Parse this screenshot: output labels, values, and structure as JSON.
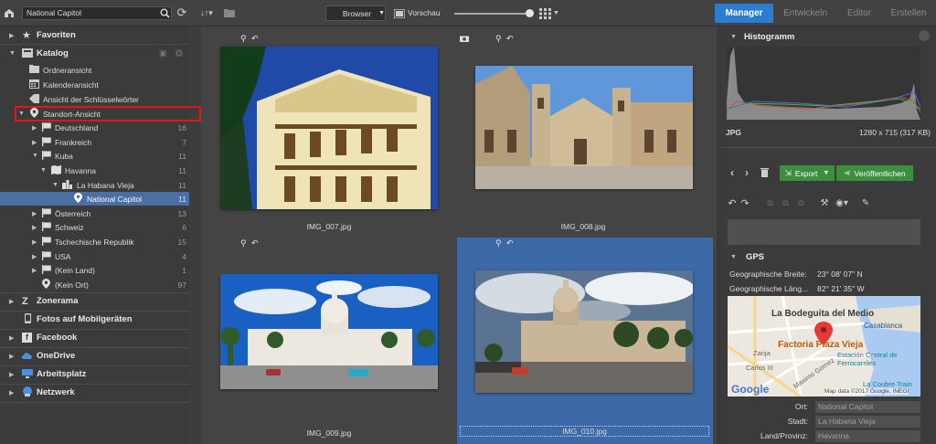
{
  "toolbar": {
    "search_value": "National Capitol",
    "browser_label": "Browser",
    "preview_label": "Vorschau"
  },
  "modes": {
    "manager": "Manager",
    "develop": "Entwickeln",
    "editor": "Editor",
    "create": "Erstellen"
  },
  "sidebar": {
    "favorites": "Favoriten",
    "catalog": "Katalog",
    "folder_view": "Ordneransicht",
    "calendar_view": "Kalenderansicht",
    "keyword_view": "Ansicht der Schlüsselwörter",
    "location_view": "Standort-Ansicht",
    "locations": [
      {
        "label": "Deutschland",
        "count": "16"
      },
      {
        "label": "Frankreich",
        "count": "7"
      },
      {
        "label": "Kuba",
        "count": "11"
      },
      {
        "label": "Havanna",
        "count": "11"
      },
      {
        "label": "La Habana Vieja",
        "count": "11"
      },
      {
        "label": "National Capitol",
        "count": "11"
      },
      {
        "label": "Österreich",
        "count": "13"
      },
      {
        "label": "Schweiz",
        "count": "6"
      },
      {
        "label": "Tschechische Republik",
        "count": "15"
      },
      {
        "label": "USA",
        "count": "4"
      },
      {
        "label": "(Kein Land)",
        "count": "1"
      },
      {
        "label": "(Kein Ort)",
        "count": "97"
      }
    ],
    "zonerama": "Zonerama",
    "mobile": "Fotos auf Mobilgeräten",
    "facebook": "Facebook",
    "onedrive": "OneDrive",
    "workspace": "Arbeitsplatz",
    "network": "Netzwerk"
  },
  "photos": [
    {
      "name": "IMG_007.jpg"
    },
    {
      "name": "IMG_008.jpg"
    },
    {
      "name": "IMG_009.jpg"
    },
    {
      "name": "IMG_010.jpg"
    }
  ],
  "right": {
    "histogram_title": "Histogramm",
    "file_type": "JPG",
    "dimensions": "1280 x 715 (317 KB)",
    "export": "Export",
    "publish": "Veröffentlichen",
    "gps_title": "GPS",
    "lat_label": "Geographische Breite:",
    "lat_value": "23° 08' 07\" N",
    "lon_label": "Geographische Läng...",
    "lon_value": "82° 21' 35\" W",
    "map": {
      "p1": "La Bodeguita del Medio",
      "p2": "Casablanca",
      "p3": "Factoria Plaza Vieja",
      "p4": "Zanja",
      "p5": "Estación Central de Ferrocarriles",
      "p6": "Carlos III",
      "p7": "Maximo Gomez",
      "p8": "La Coubre Train",
      "google": "Google",
      "copyright": "Map data ©2017 Google, INEGI"
    },
    "place_label": "Ort:",
    "place_value": "National Capitol",
    "city_label": "Stadt:",
    "city_value": "La Habana Vieja",
    "province_label": "Land/Provinz:",
    "province_value": "Havanna"
  }
}
